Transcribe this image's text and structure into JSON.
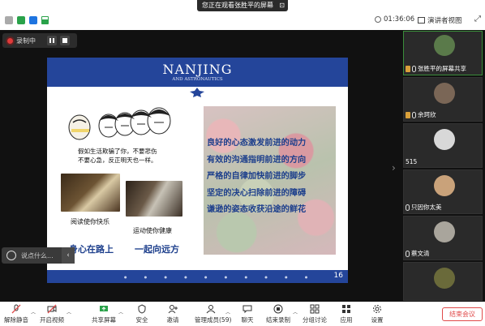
{
  "top_bar": {
    "share_banner": "您正在观看张胜平的屏幕",
    "timer": "01:36:06",
    "view_label": "演讲者视图"
  },
  "recording": {
    "label": "录制中"
  },
  "slide": {
    "university": "NANJING",
    "university_sub": "AND ASTRONAUTICS",
    "meme_caption_line1": "假如生活欺骗了你，不要悲伤",
    "meme_caption_line2": "不要心急，反正明天也一样。",
    "caption_reading": "阅读使你快乐",
    "caption_sport": "运动使你健康",
    "slogan_left": "身心在路上",
    "slogan_right": "一起向远方",
    "quotes": [
      "良好的心态激发前进的动力",
      "有效的沟通指明前进的方向",
      "严格的自律加快前进的脚步",
      "坚定的决心扫除前进的障碍",
      "谦逊的姿态收获沿途的鲜花"
    ],
    "page_number": "16"
  },
  "chat": {
    "placeholder": "说点什么..."
  },
  "participants": [
    {
      "name": "张胜平的屏幕共享",
      "color": "#5a7a4a"
    },
    {
      "name": "余珂欣",
      "color": "#7a6656"
    },
    {
      "name": "515",
      "color": "#d8d8d8"
    },
    {
      "name": "只因你太美",
      "color": "#c9a27a"
    },
    {
      "name": "蔡文清",
      "color": "#a9a59c"
    },
    {
      "name": "",
      "color": "#6a6a3a"
    }
  ],
  "toolbar": {
    "items": [
      "解除静音",
      "开启视频",
      "共享屏幕",
      "安全",
      "邀请",
      "管理成员(59)",
      "聊天",
      "结束录制",
      "分组讨论",
      "应用",
      "设置"
    ],
    "end_button": "结束会议"
  },
  "colors": {
    "slide_blue": "#24459a",
    "end_red": "#e04a4a",
    "record_red": "#e03a3a"
  }
}
